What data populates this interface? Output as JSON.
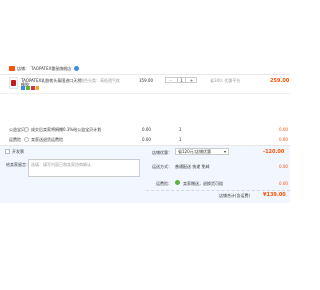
{
  "shop": {
    "label": "店铺：",
    "name": "TAOPATEX雷鼠旗舰店"
  },
  "product": {
    "title_line1": "TAOPATEX乳胶枕头泰国进口天然",
    "title_line2": "橡胶",
    "spec": "颜色分类：高低透气枕",
    "unit_price": "359.00",
    "quantity": "1",
    "promo": "省340: 优惠平台",
    "subtotal": "259.00",
    "qty_minus": "−",
    "qty_plus": "+"
  },
  "insurance": {
    "label": "公益宝贝",
    "text": "成交后卖家将捐赠0.3%给公益宝贝计划",
    "price": "0.00",
    "qty": "1",
    "subtotal": "0.00"
  },
  "freight": {
    "label": "运费险",
    "text": "卖家送退货运费险",
    "price": "0.00",
    "qty": "1",
    "subtotal": "0.00"
  },
  "anonymous": {
    "label": "开发票"
  },
  "shop_discount": {
    "label": "店铺优惠：",
    "value": "省120元:店铺优惠",
    "amount": "-120.00"
  },
  "message": {
    "label": "给卖家留言：",
    "placeholder": "选填：填写内容已和卖家协商确认"
  },
  "delivery": {
    "label": "运送方式：",
    "value": "普通配送  快递 免邮",
    "amount": "0.00"
  },
  "shipping_insurance": {
    "label": "运费险：",
    "value": "卖家赠送，退换货可赔",
    "amount": "0.00"
  },
  "total": {
    "label": "店铺合计(含运费)",
    "amount": "¥139.00"
  },
  "colors": {
    "accent": "#ff5000",
    "info_blue": "#3c8dde",
    "panel_blue": "#f2f7ff",
    "border": "#e8e8e8"
  }
}
